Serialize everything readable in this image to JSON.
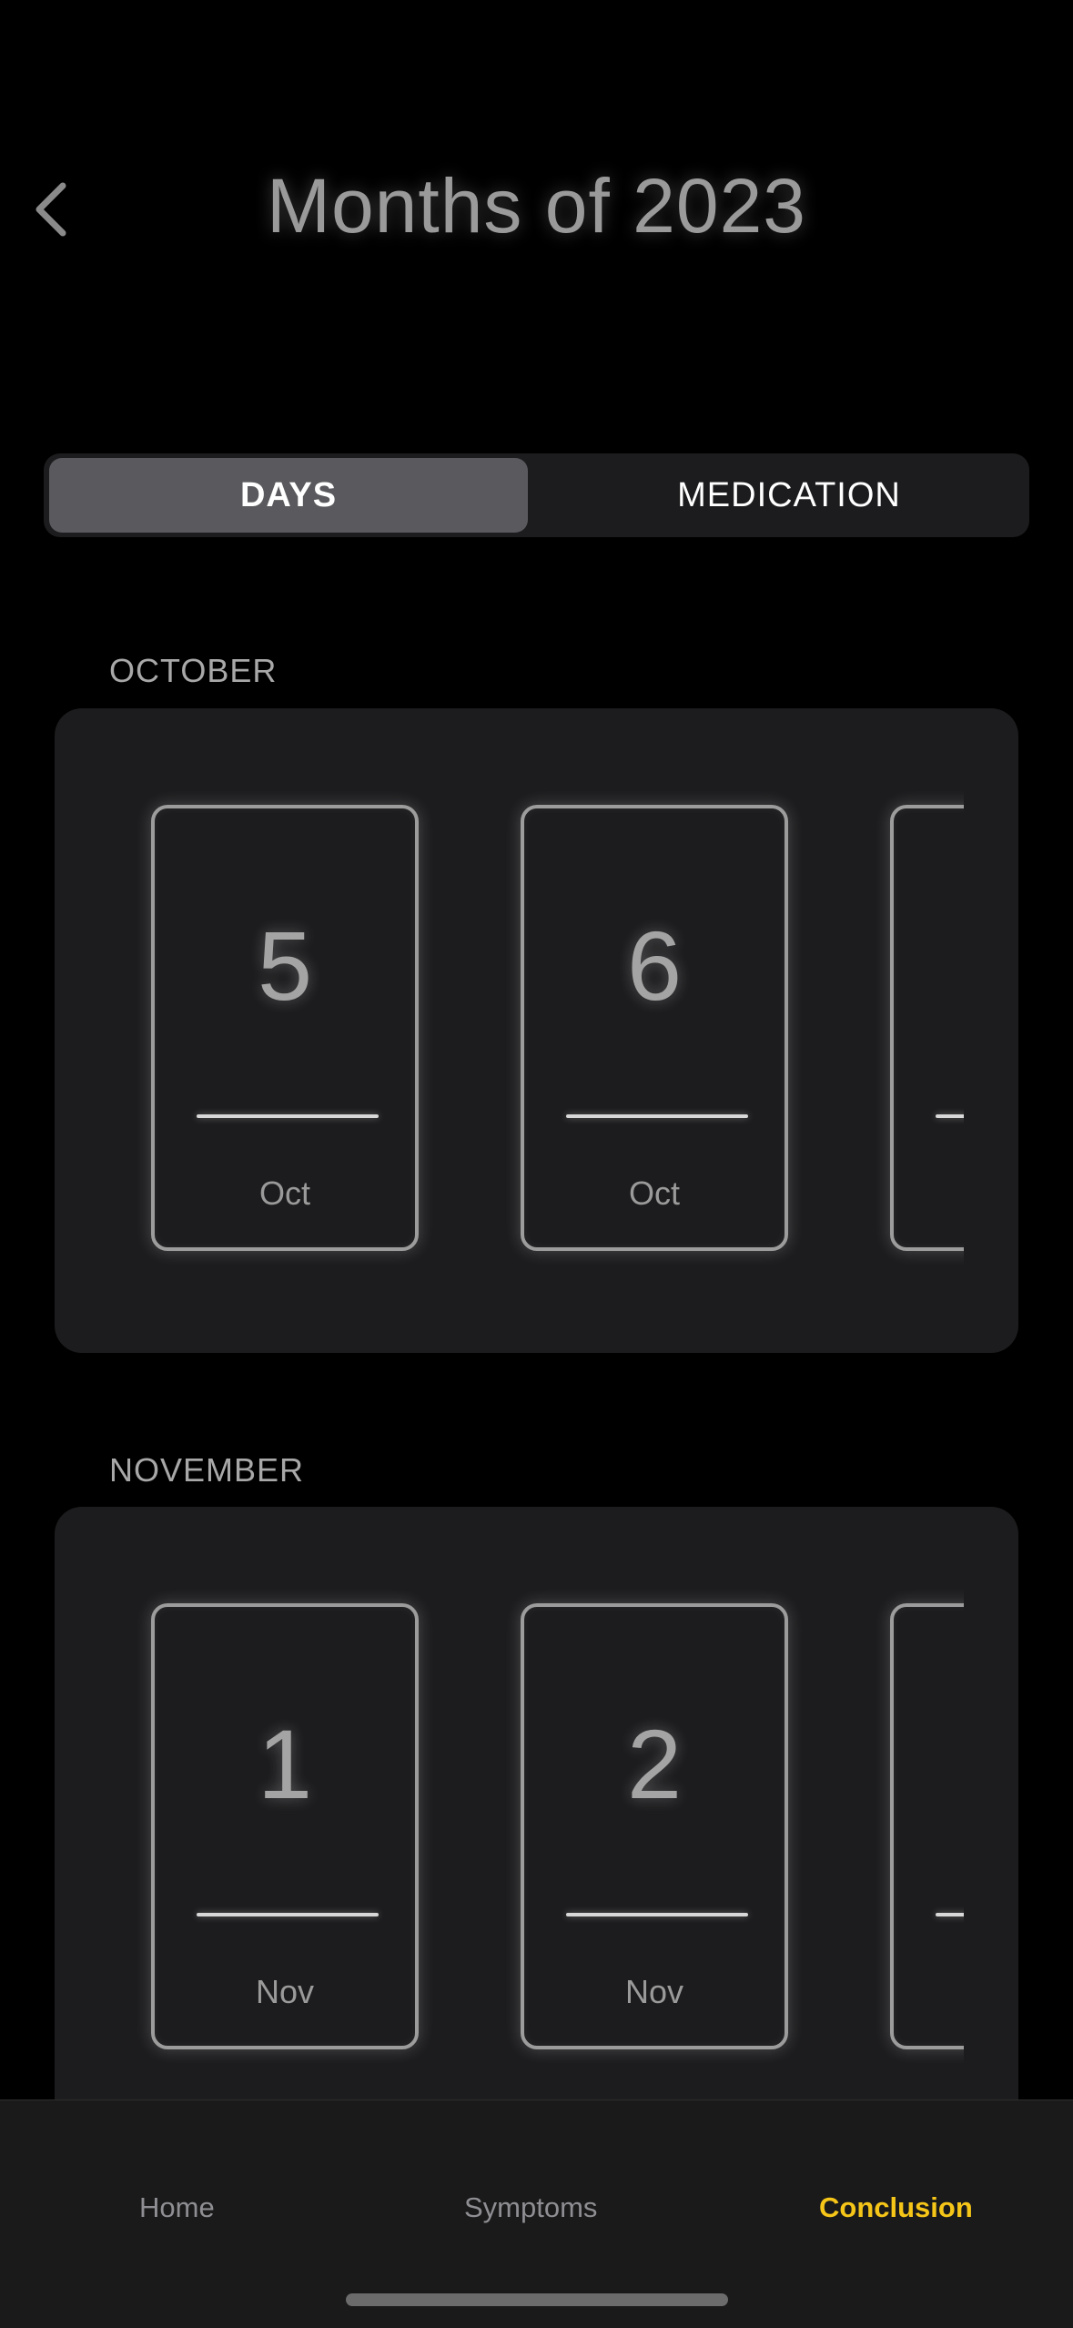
{
  "header": {
    "title": "Months of 2023",
    "back_icon": "chevron-left-icon"
  },
  "segmented_control": {
    "options": [
      "DAYS",
      "MEDICATION"
    ],
    "selected": "DAYS"
  },
  "months": [
    {
      "label": "OCTOBER",
      "days": [
        {
          "number": "5",
          "month": "Oct"
        },
        {
          "number": "6",
          "month": "Oct"
        }
      ]
    },
    {
      "label": "NOVEMBER",
      "days": [
        {
          "number": "1",
          "month": "Nov"
        },
        {
          "number": "2",
          "month": "Nov"
        }
      ]
    }
  ],
  "tab_bar": {
    "items": [
      "Home",
      "Symptoms",
      "Conclusion"
    ],
    "active": "Conclusion",
    "active_color": "#f5c518"
  }
}
